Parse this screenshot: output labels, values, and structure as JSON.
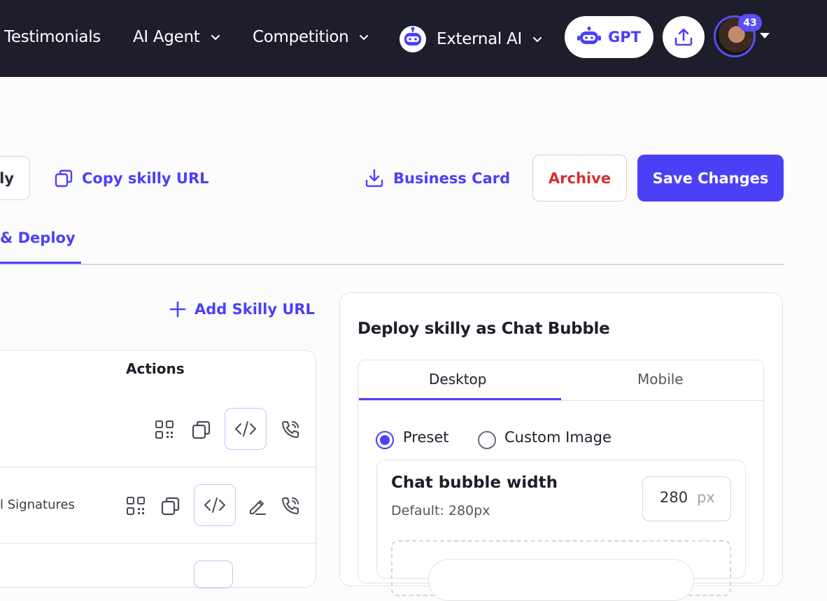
{
  "topnav": {
    "testimonials": "Testimonials",
    "ai_agent": "AI Agent",
    "competition": "Competition",
    "external_ai": "External AI",
    "gpt": "GPT",
    "notification_count": "43"
  },
  "toolbar": {
    "partial_button": "ly",
    "copy_url": "Copy skilly URL",
    "business_card": "Business Card",
    "archive": "Archive",
    "save": "Save Changes"
  },
  "tabs": {
    "active": "& Deploy"
  },
  "urls": {
    "add_url": "Add Skilly URL",
    "actions_header": "Actions",
    "row2_label": "l Signatures"
  },
  "deploy": {
    "title": "Deploy skilly as Chat Bubble",
    "tab_desktop": "Desktop",
    "tab_mobile": "Mobile",
    "radio_preset": "Preset",
    "radio_custom": "Custom Image",
    "width_title": "Chat bubble width",
    "width_default": "Default: 280px",
    "width_value": "280",
    "width_unit": "px"
  },
  "colors": {
    "accent": "#4c40f7",
    "topbar": "#1e1d2b",
    "danger": "#d3302f"
  }
}
